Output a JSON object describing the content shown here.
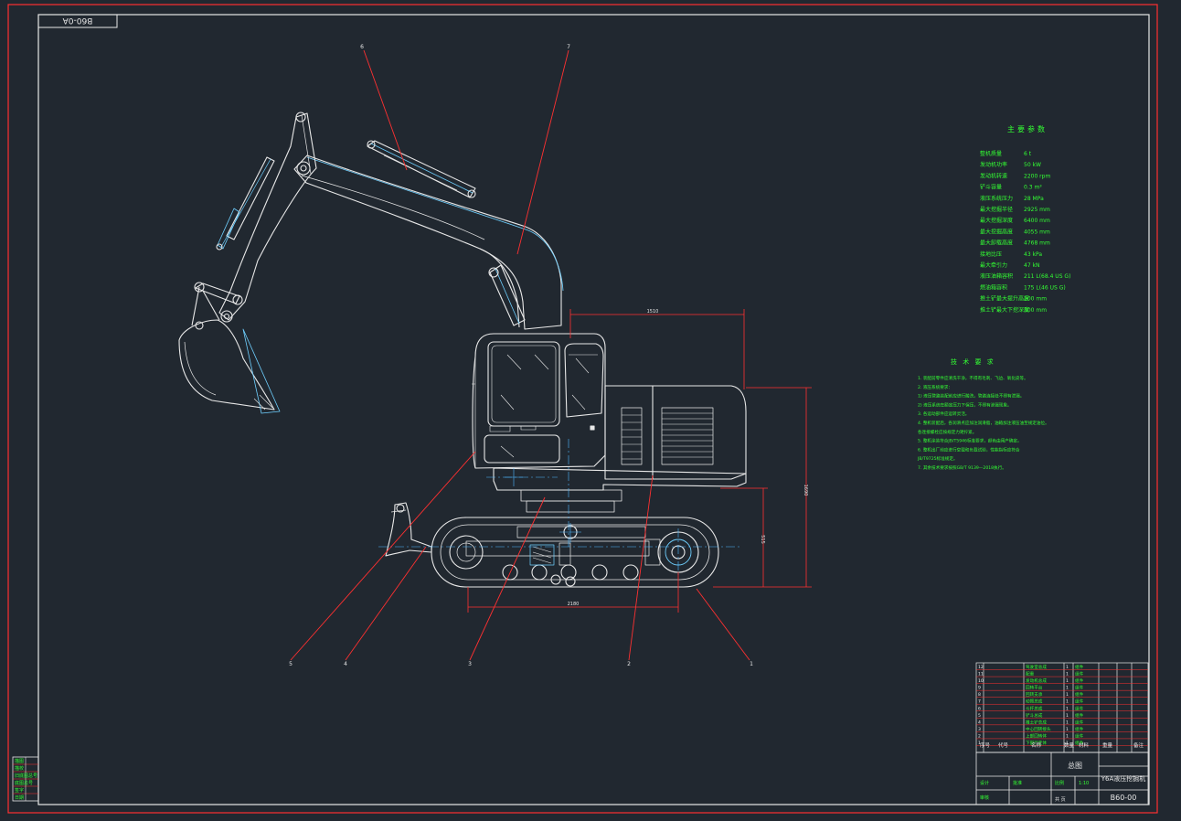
{
  "drawing": {
    "code_box": "B60-0A",
    "balloons": [
      "1",
      "2",
      "3",
      "4",
      "5",
      "6",
      "7"
    ],
    "dims": {
      "cab_width": "1510",
      "track_length": "2180",
      "overall_height": "1690",
      "track_height": "515"
    }
  },
  "specs": {
    "title": "主要参数",
    "items": [
      {
        "label": "整机质量",
        "value": "6 t"
      },
      {
        "label": "发动机功率",
        "value": "50 kW"
      },
      {
        "label": "发动机转速",
        "value": "2200 rpm"
      },
      {
        "label": "铲斗容量",
        "value": "0.3 m³"
      },
      {
        "label": "液压系统压力",
        "value": "28 MPa"
      },
      {
        "label": "最大挖掘半径",
        "value": "2925 mm"
      },
      {
        "label": "最大挖掘深度",
        "value": "6400 mm"
      },
      {
        "label": "最大挖掘高度",
        "value": "4055 mm"
      },
      {
        "label": "最大卸载高度",
        "value": "4768 mm"
      },
      {
        "label": "接地比压",
        "value": "43 kPa"
      },
      {
        "label": "最大牵引力",
        "value": "47 kN"
      },
      {
        "label": "液压油箱容积",
        "value": "211 L(68.4 US G)"
      },
      {
        "label": "燃油箱容积",
        "value": "175 L(46 US G)"
      },
      {
        "label": "推土铲最大提升高度",
        "value": "200 mm"
      },
      {
        "label": "推土铲最大下挖深度",
        "value": "300 mm"
      }
    ]
  },
  "tech": {
    "title": "技 术 要 求",
    "items": [
      "1. 装配前零件应清洗干净，不得有毛刺、飞边、氧化皮等。",
      "2. 液压系统要求：",
      "   1) 液压管路装配前应进行酸洗，管路连接处不得有泄漏。",
      "   2) 液压系统在额定压力下保压，不得有渗漏现象。",
      "3. 各运动部件应运转灵活。",
      "4. 整机装配后，各润滑点应加注润滑脂，油箱加注液压油至规定油位。",
      "   各连接螺栓应按规定力矩拧紧。",
      "5. 整机涂装符合JB/T5946标准要求，颜色由用户确定。",
      "6. 整机出厂前应进行空载和负载试验，性能指标应符合",
      "   JB/T9725标准规定。",
      "7. 其余技术要求按照GB/T 9139—2018执行。"
    ]
  },
  "bom": {
    "rows": [
      {
        "no": "12",
        "name": "驾驶室总成",
        "qty": "1",
        "mat": "组件"
      },
      {
        "no": "11",
        "name": "配重",
        "qty": "1",
        "mat": "组件"
      },
      {
        "no": "10",
        "name": "发动机总成",
        "qty": "1",
        "mat": "组件"
      },
      {
        "no": "9",
        "name": "回转平台",
        "qty": "1",
        "mat": "组件"
      },
      {
        "no": "8",
        "name": "回转支承",
        "qty": "1",
        "mat": "组件"
      },
      {
        "no": "7",
        "name": "动臂总成",
        "qty": "1",
        "mat": "组件"
      },
      {
        "no": "6",
        "name": "斗杆总成",
        "qty": "1",
        "mat": "组件"
      },
      {
        "no": "5",
        "name": "铲斗总成",
        "qty": "1",
        "mat": "组件"
      },
      {
        "no": "4",
        "name": "推土铲总成",
        "qty": "1",
        "mat": "组件"
      },
      {
        "no": "3",
        "name": "中心回转接头",
        "qty": "1",
        "mat": "组件"
      },
      {
        "no": "2",
        "name": "上部回转体",
        "qty": "1",
        "mat": "组件"
      },
      {
        "no": "1",
        "name": "下部行走体",
        "qty": "1",
        "mat": "组件"
      }
    ],
    "header": {
      "no": "序号",
      "code": "代号",
      "name": "名称",
      "qty": "数量",
      "mat": "材料",
      "weight": "重量",
      "note": "备注"
    }
  },
  "title_block": {
    "drawing_name": "总图",
    "product": "Y6A液压挖掘机",
    "drawing_no": "B60-00",
    "scale_label": "比例",
    "scale": "1:10",
    "sheet": "共 页",
    "designer": "设计",
    "checker": "审核",
    "approver": "批准"
  },
  "left_stamp": {
    "rows": [
      "描图",
      "描校",
      "旧底图总号",
      "底图总号",
      "签字",
      "日期"
    ]
  }
}
